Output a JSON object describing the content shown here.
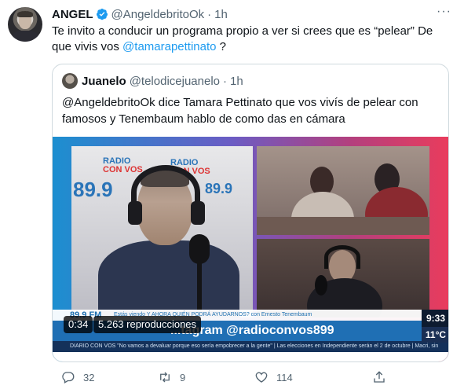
{
  "tweet": {
    "name": "ANGEL",
    "handle": "@AngeldebritoOk",
    "dot": "·",
    "time": "1h",
    "more": "···",
    "text_part1": "Te invito a conducir un programa propio a ver si crees que es “pelear”  De que vivis vos ",
    "mention": "@tamarapettinato",
    "text_part2": " ?"
  },
  "quote": {
    "name": "Juanelo",
    "handle": "@telodicejuanelo",
    "dot": "·",
    "time": "1h",
    "text": "@AngeldebritoOk dice Tamara Pettinato que vos vivís de pelear con famosos y Tenembaum hablo de como das en cámara"
  },
  "video": {
    "elapsed": "0:34",
    "views": "5.263 reproducciones",
    "overlay": {
      "frequency": "89.9 FM",
      "now_watching": "Estás viendo Y AHORA QUIÉN PODRÁ AYUDARNOS? con Ernesto Tenembaum",
      "instagram": "...tagram @radioconvos899",
      "ticker": "DIARIO CON VOS  \"No vamos a devaluar porque eso sería empobrecer a la gente\"  |  Las elecciones en Independiente serán el 2 de octubre  |  Macri, sin",
      "clock": "9:33",
      "temperature": "11°C",
      "logo_line1": "RADIO",
      "logo_line2": "CON VOS",
      "big_number": "89.9"
    }
  },
  "actions": {
    "replies": "32",
    "retweets": "9",
    "likes": "114"
  },
  "colors": {
    "accent": "#1d9bf0",
    "secondary_text": "#536471",
    "border": "#cfd9de"
  },
  "icons": [
    "verified-badge-icon",
    "more-icon",
    "reply-icon",
    "retweet-icon",
    "like-icon",
    "share-icon"
  ]
}
